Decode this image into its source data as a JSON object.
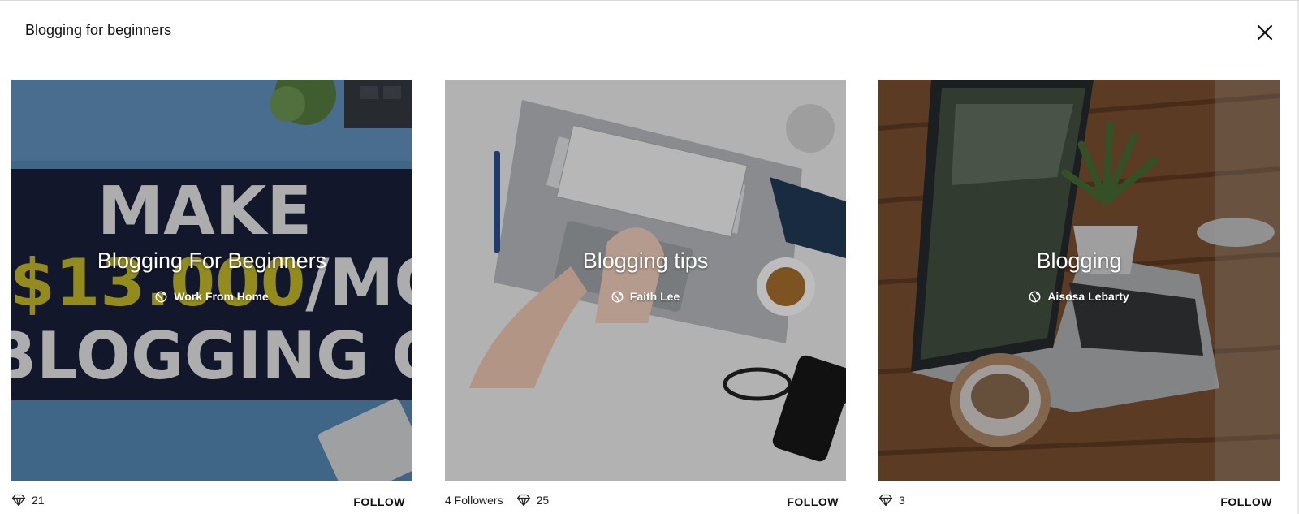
{
  "modal": {
    "title": "Blogging for beginners",
    "close_icon": "close-icon"
  },
  "collections": [
    {
      "title": "Blogging For Beginners",
      "author": "Work From Home",
      "followers": "",
      "likes": "21",
      "follow_label": "FOLLOW",
      "image_text": {
        "line1": "MAKE",
        "amount": "$13.000",
        "per_month": "/MONTH",
        "line3": "BLOGGING ONLINE"
      }
    },
    {
      "title": "Blogging tips",
      "author": "Faith Lee",
      "followers": "4 Followers",
      "likes": "25",
      "follow_label": "FOLLOW"
    },
    {
      "title": "Blogging",
      "author": "Aisosa Lebarty",
      "followers": "",
      "likes": "3",
      "follow_label": "FOLLOW"
    }
  ],
  "colors": {
    "overlay": "rgba(0,0,0,0.32)",
    "accent_yellow": "#d9cf2a",
    "navy": "#1c2340",
    "blue": "#5b9bd5"
  }
}
